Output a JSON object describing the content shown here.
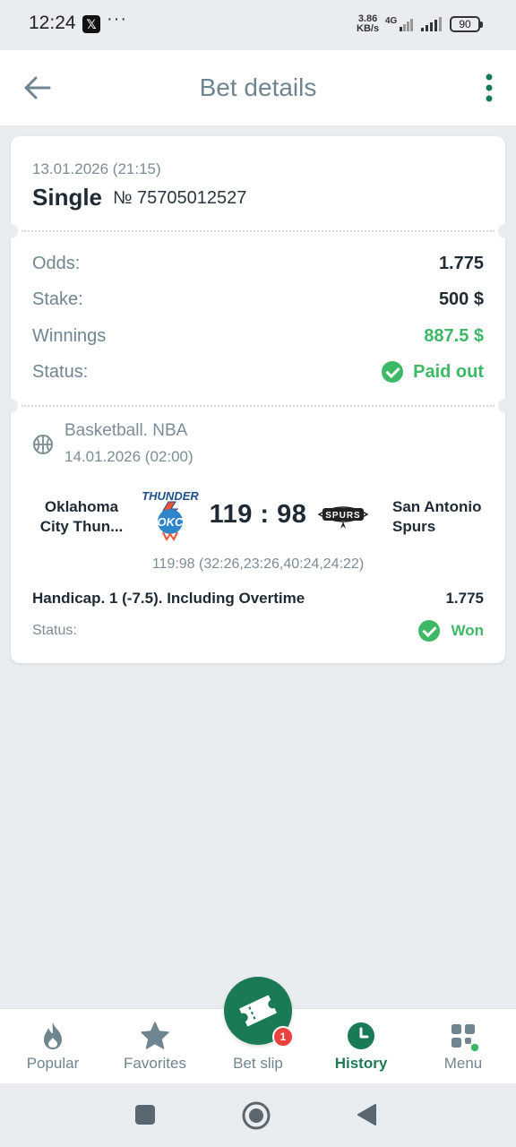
{
  "status_bar": {
    "time": "12:24",
    "app_icon": "x-icon",
    "app_glyph": "𝕏",
    "more": "···",
    "speed_value": "3.86",
    "speed_unit": "KB/s",
    "network": "4G",
    "battery": "90"
  },
  "header": {
    "title": "Bet details",
    "back_icon": "arrow-left-icon",
    "menu_icon": "more-vertical-icon"
  },
  "bet": {
    "date": "13.01.2026 (21:15)",
    "type": "Single",
    "number": "№ 75705012527",
    "rows": {
      "odds_label": "Odds:",
      "odds_value": "1.775",
      "stake_label": "Stake:",
      "stake_value": "500 $",
      "winnings_label": "Winnings",
      "winnings_value": "887.5 $",
      "status_label": "Status:",
      "status_value": "Paid out"
    }
  },
  "event": {
    "sport_icon": "basketball-icon",
    "league": "Basketball. NBA",
    "date": "14.01.2026 (02:00)",
    "team1_line1": "Oklahoma",
    "team1_line2": "City Thun...",
    "team1_logo": "thunder-logo",
    "score": "119 : 98",
    "team2_logo": "spurs-logo",
    "team2_line1": "San Antonio",
    "team2_line2": "Spurs",
    "periods": "119:98 (32:26,23:26,40:24,24:22)",
    "market": "Handicap. 1 (-7.5). Including Overtime",
    "market_odds": "1.775",
    "status_label": "Status:",
    "status_value": "Won",
    "logo_text_1": "THUNDER",
    "logo_text_1b": "OKC",
    "logo_text_2": "SPURS"
  },
  "bottom_nav": {
    "items": [
      {
        "label": "Popular",
        "icon": "flame-icon"
      },
      {
        "label": "Favorites",
        "icon": "star-icon"
      },
      {
        "label": "Bet slip",
        "icon": "ticket-icon",
        "badge": "1"
      },
      {
        "label": "History",
        "icon": "clock-icon",
        "active": true
      },
      {
        "label": "Menu",
        "icon": "grid-icon"
      }
    ]
  },
  "colors": {
    "accent_green": "#1a7a55",
    "success_green": "#3db867",
    "badge_red": "#e9423d",
    "muted_text": "#6f8590",
    "background": "#e9edf0"
  }
}
